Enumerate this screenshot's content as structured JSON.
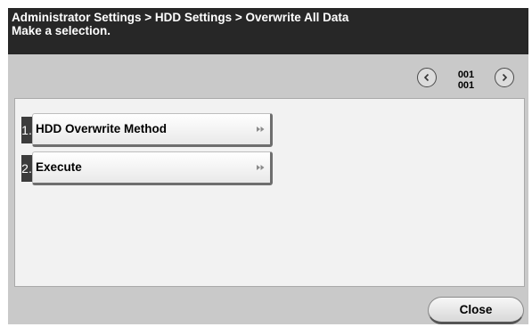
{
  "header": {
    "breadcrumb": "Administrator Settings > HDD Settings > Overwrite All Data",
    "instruction": "Make a selection."
  },
  "pager": {
    "current": "001",
    "total": "001"
  },
  "menu": {
    "items": [
      {
        "number": "1.",
        "label": "HDD Overwrite Method"
      },
      {
        "number": "2.",
        "label": "Execute"
      }
    ]
  },
  "footer": {
    "close_label": "Close"
  },
  "icons": {
    "prev": "chevron-left-icon",
    "next": "chevron-right-icon",
    "submenu": "double-chevron-right-icon"
  },
  "colors": {
    "header_bg": "#272727",
    "panel_bg": "#c9c9c9",
    "content_bg": "#f2f2f2",
    "number_tab_bg": "#3c3c3c"
  }
}
